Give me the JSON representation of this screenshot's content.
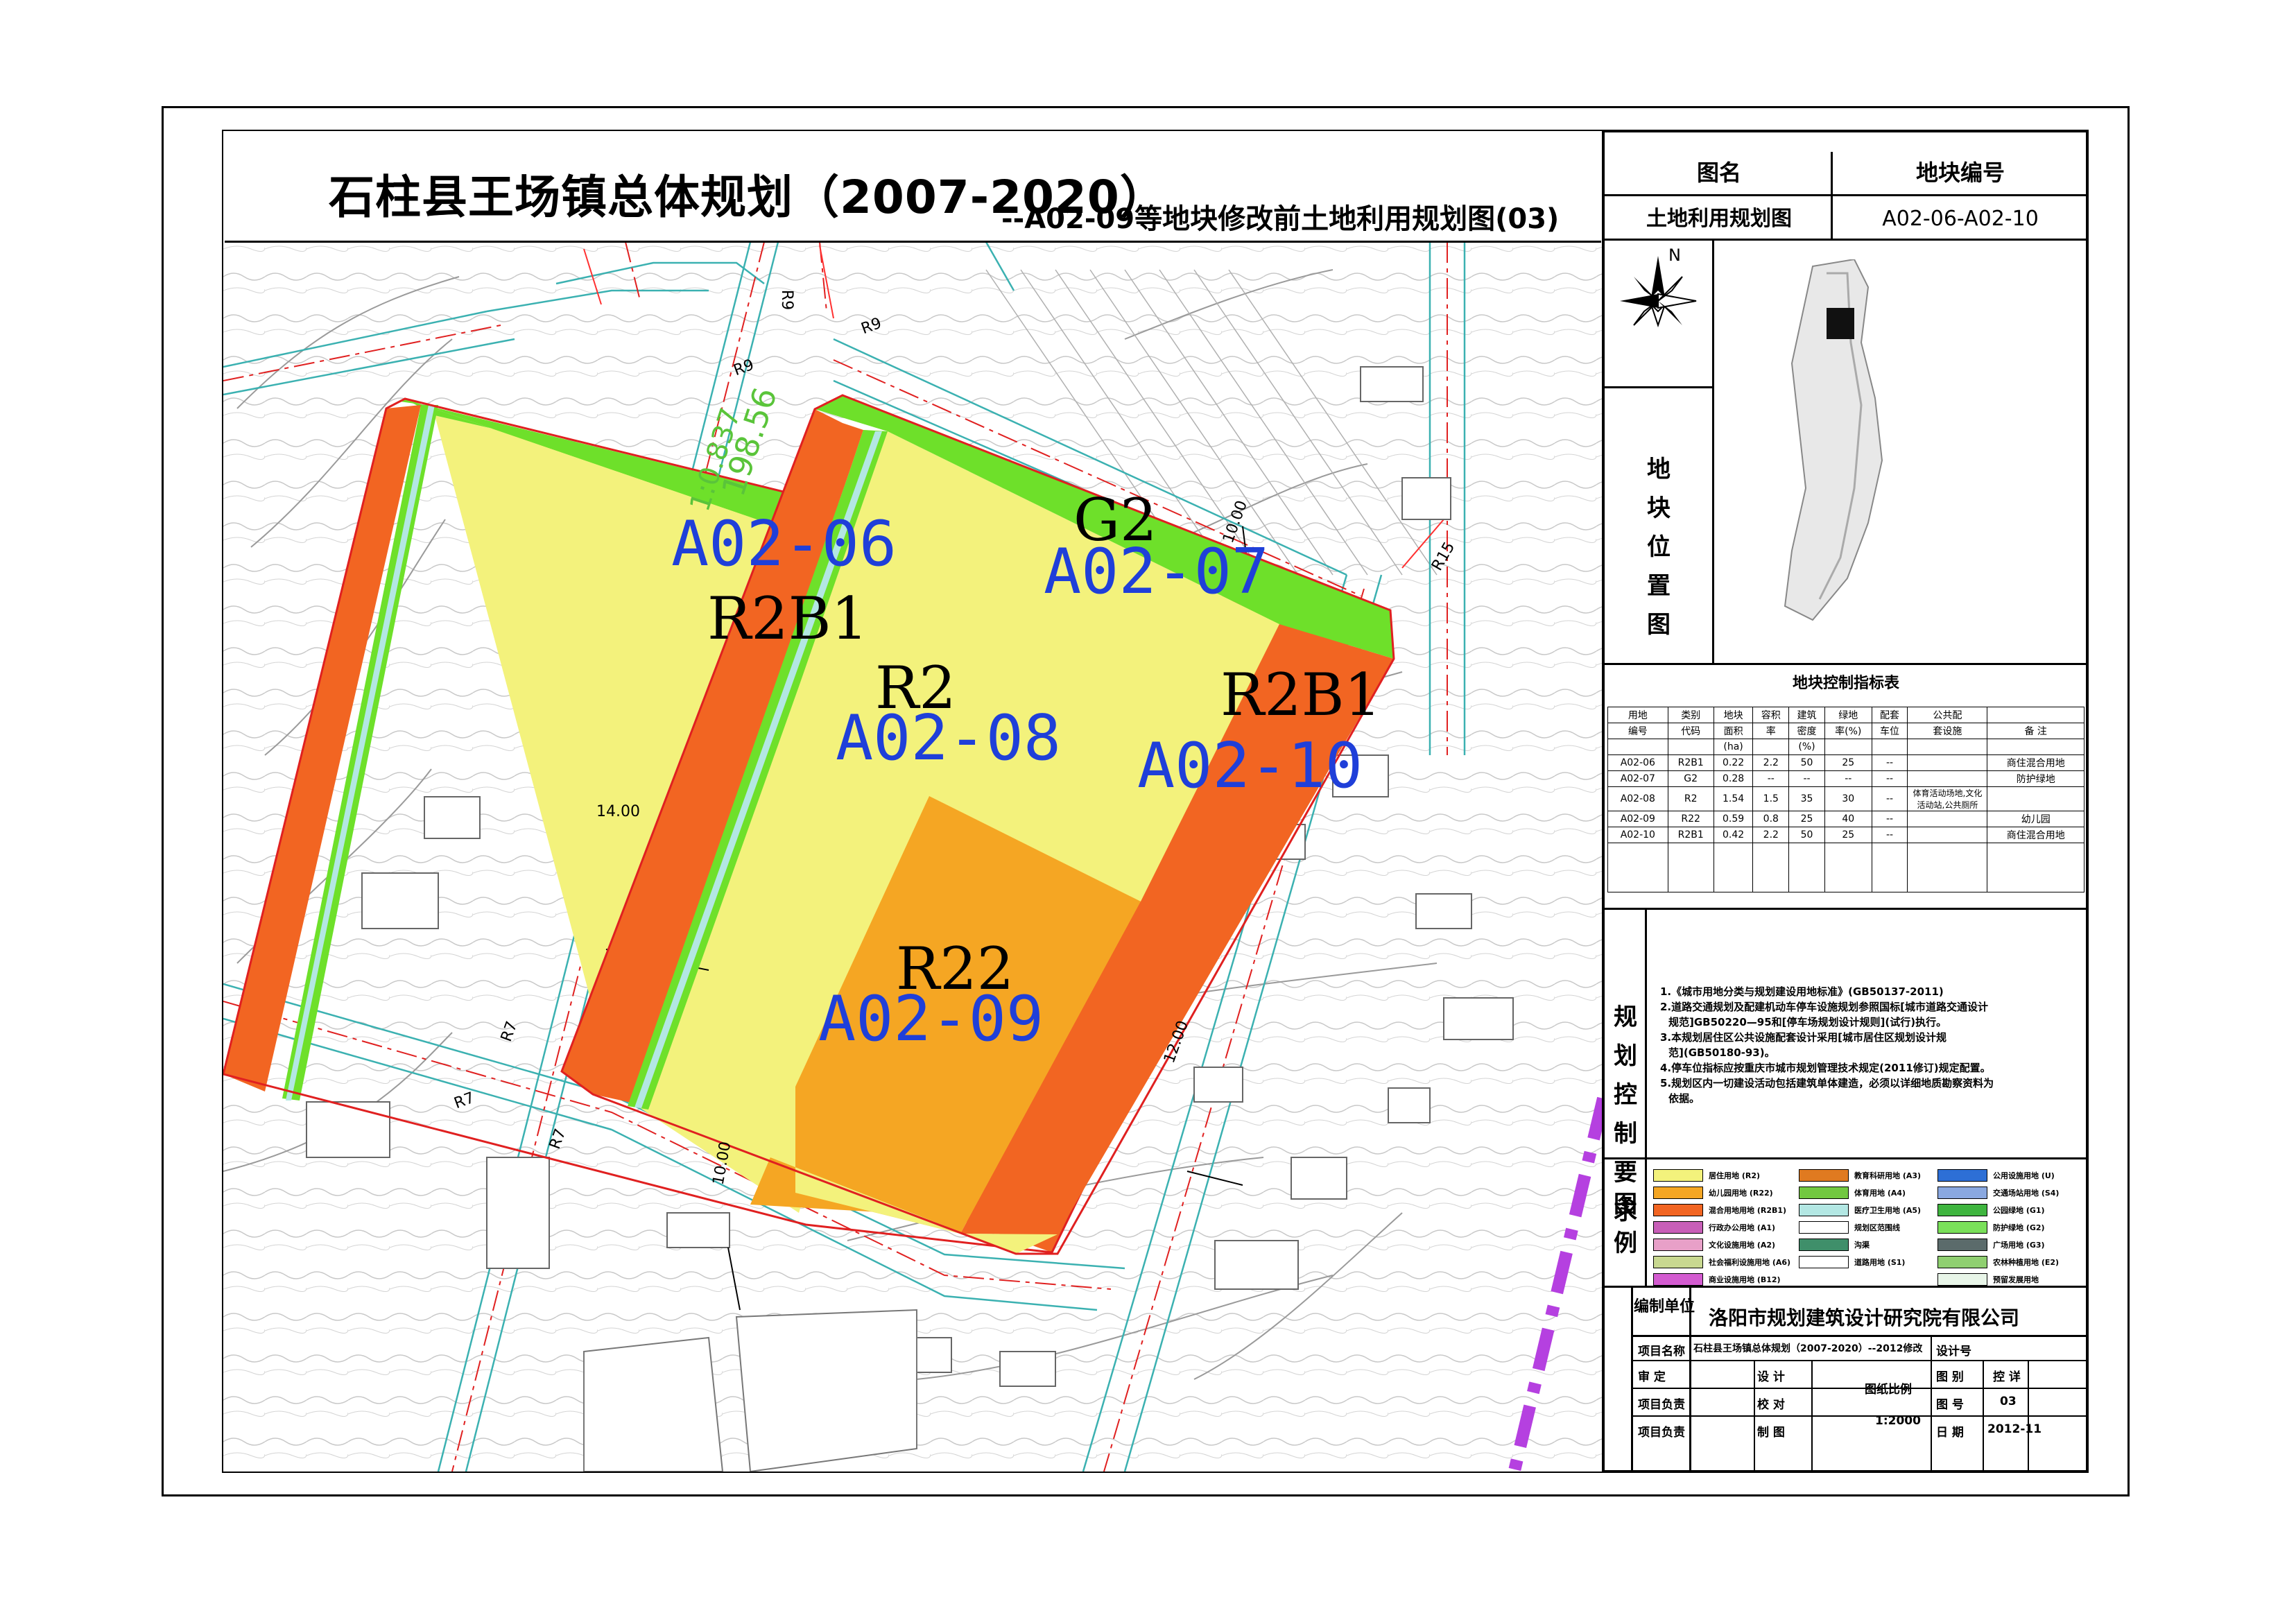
{
  "title": {
    "main": "石柱县王场镇总体规划（2007-2020）",
    "sub": "--A02-09等地块修改前土地利用规划图(03)"
  },
  "header": {
    "col1_label": "图名",
    "col2_label": "地块编号",
    "col1_value": "土地利用规划图",
    "col2_value": "A02-06-A02-10"
  },
  "location_map": {
    "label": "地块位置图",
    "north_label": "N"
  },
  "control_table": {
    "title": "地块控制指标表",
    "headers_row1": [
      "用地",
      "类别",
      "地块",
      "容积",
      "建筑",
      "绿地",
      "配套",
      "公共配",
      ""
    ],
    "headers_row2": [
      "编号",
      "代码",
      "面积",
      "率",
      "密度",
      "率(%)",
      "车位",
      "套设施",
      "备  注"
    ],
    "headers_row3": [
      "",
      "",
      "(ha)",
      "",
      "(%)",
      "",
      "",
      "",
      ""
    ],
    "rows": [
      [
        "A02-06",
        "R2B1",
        "0.22",
        "2.2",
        "50",
        "25",
        "--",
        "",
        "商住混合用地"
      ],
      [
        "A02-07",
        "G2",
        "0.28",
        "--",
        "--",
        "--",
        "--",
        "",
        "防护绿地"
      ],
      [
        "A02-08",
        "R2",
        "1.54",
        "1.5",
        "35",
        "30",
        "--",
        "体育活动场地,文化活动站,公共厕所",
        ""
      ],
      [
        "A02-09",
        "R22",
        "0.59",
        "0.8",
        "25",
        "40",
        "--",
        "",
        "幼儿园"
      ],
      [
        "A02-10",
        "R2B1",
        "0.42",
        "2.2",
        "50",
        "25",
        "--",
        "",
        "商住混合用地"
      ]
    ]
  },
  "requirements": {
    "label": "规划控制要求",
    "items": [
      "1.《城市用地分类与规划建设用地标准》(GB50137-2011)",
      "2.道路交通规划及配建机动车停车设施规划参照国标[城市道路交通设计",
      "规范]GB50220—95和[停车场规划设计规则](试行)执行。",
      "3.本规划居住区公共设施配套设计采用[城市居住区规划设计规",
      "范](GB50180-93)。",
      "4.停车位指标应按重庆市城市规划管理技术规定(2011修订)规定配置。",
      "5.规划区内一切建设活动包括建筑单体建造，必须以详细地质勘察资料为",
      "依据。"
    ]
  },
  "legend": {
    "label": "图例",
    "col1": [
      {
        "name": "居住用地 (R2)",
        "color": "#f3f27c"
      },
      {
        "name": "幼儿园用地 (R22)",
        "color": "#f5a623"
      },
      {
        "name": "混合用地用地 (R2B1)",
        "color": "#f26522"
      },
      {
        "name": "行政办公用地 (A1)",
        "color": "#c85fb8"
      },
      {
        "name": "文化设施用地 (A2)",
        "color": "#e8a0c8"
      },
      {
        "name": "社会福利设施用地 (A6)",
        "color": "#c8d890"
      },
      {
        "name": "商业设施用地 (B12)",
        "color": "#d35bd0"
      }
    ],
    "col2": [
      {
        "name": "教育科研用地 (A3)",
        "color": "#e07a20"
      },
      {
        "name": "体育用地 (A4)",
        "color": "#72c840"
      },
      {
        "name": "医疗卫生用地 (A5)",
        "color": "#b3e7e3"
      },
      {
        "name": "规划区范围线",
        "color": "#ffffff"
      },
      {
        "name": "沟渠",
        "color": "#3f8f6a"
      },
      {
        "name": "道路用地 (S1)",
        "color": "#ffffff"
      }
    ],
    "col3": [
      {
        "name": "公用设施用地 (U)",
        "color": "#2d6fd6"
      },
      {
        "name": "交通场站用地 (S4)",
        "color": "#8aa8e0"
      },
      {
        "name": "公园绿地 (G1)",
        "color": "#3fb53f"
      },
      {
        "name": "防护绿地 (G2)",
        "color": "#7ae05a"
      },
      {
        "name": "广场用地 (G3)",
        "color": "#5b6b6b"
      },
      {
        "name": "农林种植用地 (E2)",
        "color": "#8fcf70"
      },
      {
        "name": "预留发展用地",
        "color": "#e8f5e8"
      }
    ]
  },
  "title_block": {
    "unit_label": "编制单位",
    "unit_name": "洛阳市规划建筑设计研究院有限公司",
    "project_label": "项目名称",
    "project_name": "石柱县王场镇总体规划（2007-2020）--2012修改",
    "design_no_label": "设计号",
    "review_label": "审    定",
    "design_label": "设    计",
    "scale_label": "图纸比例",
    "scale_value": "1:2000",
    "sheet_label": "图    别",
    "sheet_value": "控    详",
    "leader_label": "项目负责",
    "check_label": "校    对",
    "drawing_no_label": "图    号",
    "drawing_no_value": "03",
    "leader2_label": "项目负责",
    "draw_label": "制    图",
    "date_label": "日    期",
    "date_value": "2012-11"
  },
  "map_labels": {
    "a0206": "A02-06",
    "a0207": "A02-07",
    "a0208": "A02-08",
    "a0209": "A02-09",
    "a0210": "A02-10",
    "r2b1_w": "R2B1",
    "r2b1_e": "R2B1",
    "r2": "R2",
    "r22": "R22",
    "g2": "G2",
    "road_r9a": "R9",
    "road_r9b": "R9",
    "road_r9c": "R9",
    "road_r7a": "R7",
    "road_r7b": "R7",
    "road_r7c": "R7",
    "road_r15": "R15",
    "dim_14": "14.00",
    "dim_12": "12.00",
    "dim_10a": "10.00",
    "dim_10b": "10.00",
    "elev_a": "198.56",
    "elev_b": "1:0.837"
  },
  "colors": {
    "residential": "#f3f27c",
    "kindergarten": "#f5a623",
    "mixed": "#f26522",
    "green_buffer": "#6ee02a",
    "canal": "#b3e7e3",
    "label_blue": "#1f3fd9",
    "boundary_purple": "#b540e0"
  }
}
